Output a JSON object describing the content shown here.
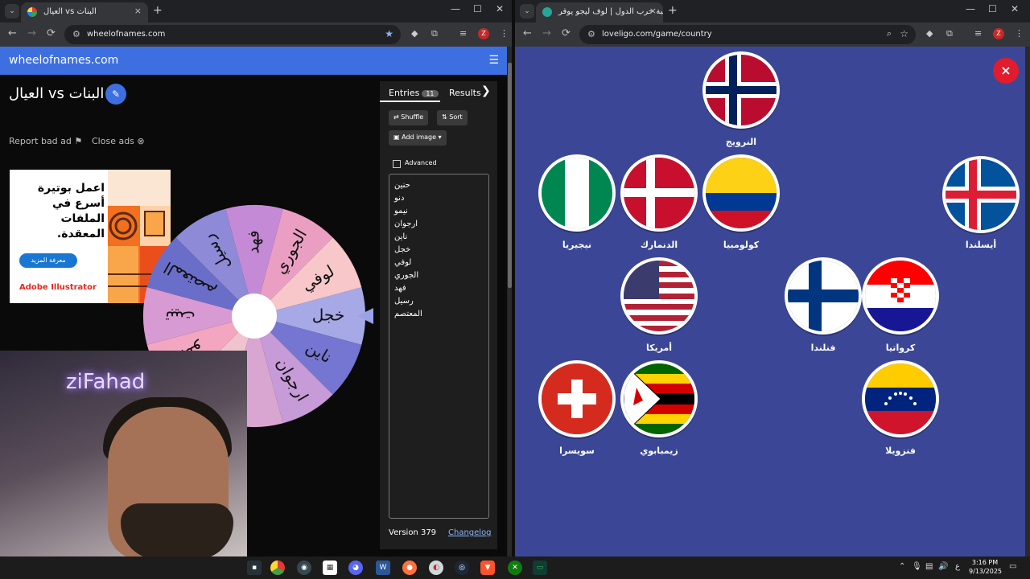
{
  "left_browser": {
    "tab_title": "العيال vs البنات",
    "url": "wheelofnames.com",
    "profile_letter": "Z"
  },
  "wheel_site": {
    "logo": "wheelofnames.com",
    "wheel_title": "البنات vs العيال",
    "report_bad_ad": "Report bad ad",
    "close_ads": "Close ads",
    "ad": {
      "headline": "اعمل بوتيرة أسرع في الملفات المعقدة.",
      "button": "معرفة المزيد",
      "brand": "Adobe Illustrator"
    },
    "tabs": {
      "entries_label": "Entries",
      "entries_count": "11",
      "results_label": "Results"
    },
    "buttons": {
      "shuffle": "Shuffle",
      "sort": "Sort",
      "add_image": "Add image",
      "advanced": "Advanced"
    },
    "entries": [
      "حنين",
      "دنو",
      "نيمو",
      "ارجوان",
      "ناين",
      "خجل",
      "لوفي",
      "الجوري",
      "فهد",
      "رسيل",
      "المعتصم"
    ],
    "version": "Version 379",
    "changelog": "Changelog",
    "wheel_segments": [
      {
        "label": "خجل",
        "color": "#a7a8e6"
      },
      {
        "label": "ناين",
        "color": "#7575d2"
      },
      {
        "label": "ارجوان",
        "color": "#c79ad8"
      },
      {
        "label": "",
        "color": "#d9a6d1"
      },
      {
        "label": "",
        "color": "#f0c3cf"
      },
      {
        "label": "نيمو",
        "color": "#f3a6c0"
      },
      {
        "label": "تبيت",
        "color": "#d89ad3"
      },
      {
        "label": "المعتصم",
        "color": "#6b6ec9"
      },
      {
        "label": "رسيل",
        "color": "#8e8ad8"
      },
      {
        "label": "فهد",
        "color": "#c58ad6"
      },
      {
        "label": "الجوري",
        "color": "#ea9fc2"
      },
      {
        "label": "لوفي",
        "color": "#f7c7c9"
      }
    ]
  },
  "webcam": {
    "neon_text": "ziFahad"
  },
  "right_browser": {
    "tab_title": "لعبة حرب الدول | لوف ليجو يوفر...",
    "url": "loveligo.com/game/country",
    "profile_letter": "Z"
  },
  "game": {
    "close_label": "×",
    "countries": [
      {
        "name": "النرويج",
        "flag": "norway"
      },
      {
        "name": "نيجيريا",
        "flag": "nigeria"
      },
      {
        "name": "الدنمارك",
        "flag": "denmark"
      },
      {
        "name": "كولومبيا",
        "flag": "colombia"
      },
      {
        "name": "أيسلندا",
        "flag": "iceland"
      },
      {
        "name": "أمريكا",
        "flag": "usa"
      },
      {
        "name": "فنلندا",
        "flag": "finland"
      },
      {
        "name": "كرواتيا",
        "flag": "croatia"
      },
      {
        "name": "سويسرا",
        "flag": "switzerland"
      },
      {
        "name": "زيمبابوي",
        "flag": "zimbabwe"
      },
      {
        "name": "فنزويلا",
        "flag": "venezuela"
      }
    ]
  },
  "taskbar": {
    "time": "3:16 PM",
    "date": "9/13/2025",
    "lang": "ع"
  }
}
